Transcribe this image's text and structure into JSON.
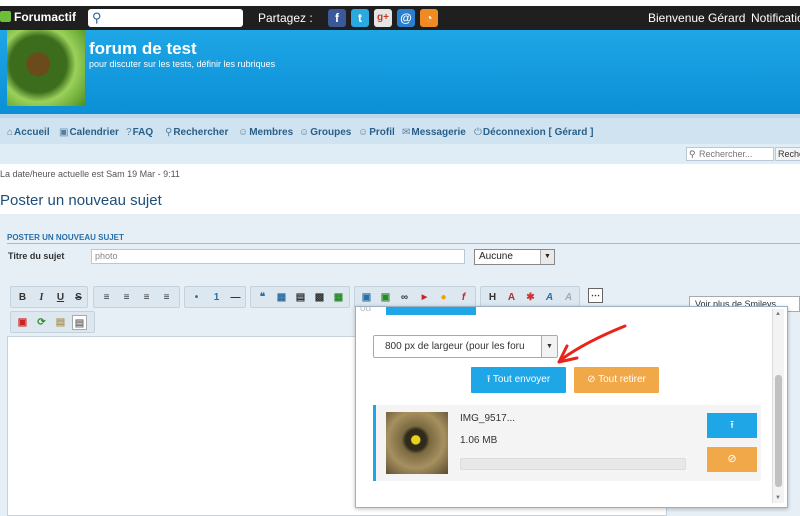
{
  "topbar": {
    "brand": "Forumactif",
    "share_label": "Partagez :",
    "social": [
      {
        "icon": "facebook-icon",
        "glyph": "f",
        "color": "#3b5998"
      },
      {
        "icon": "twitter-icon",
        "glyph": "t",
        "color": "#2aa9e0"
      },
      {
        "icon": "google-plus-icon",
        "glyph": "g+",
        "color": "#d9d9d9"
      },
      {
        "icon": "email-icon",
        "glyph": "@",
        "color": "#2a7fd0"
      },
      {
        "icon": "rss-icon",
        "glyph": "◔",
        "color": "#f08a24"
      }
    ],
    "welcome": "Bienvenue Gérard",
    "notifications": "Notification"
  },
  "header": {
    "title": "forum de test",
    "subtitle": "pour discuter sur les tests, définir les rubriques"
  },
  "nav": {
    "items": [
      {
        "label": "Accueil",
        "icon": "⌂"
      },
      {
        "label": "Calendrier",
        "icon": "▣"
      },
      {
        "label": "FAQ",
        "icon": "?"
      },
      {
        "label": "Rechercher",
        "icon": "⚲"
      },
      {
        "label": "Membres",
        "icon": "☺"
      },
      {
        "label": "Groupes",
        "icon": "☺"
      },
      {
        "label": "Profil",
        "icon": "☺"
      },
      {
        "label": "Messagerie",
        "icon": "✉"
      },
      {
        "label": "Déconnexion [ Gérard ]",
        "icon": "⏻"
      }
    ],
    "search_placeholder": "Rechercher...",
    "search_button": "Reche"
  },
  "date_text": "La date/heure actuelle est Sam 19 Mar - 9:11",
  "page_title": "Poster un nouveau sujet",
  "form": {
    "section_header": "POSTER UN NOUVEAU SUJET",
    "subject_label": "Titre du sujet",
    "subject_value": "photo",
    "icon_select": "Aucune",
    "more_smileys": "Voir plus de Smileys"
  },
  "upload": {
    "resize_option": "800 px de largeur (pour les foru",
    "send_all": "⭱ Tout envoyer",
    "remove_all": "⊘ Tout retirer",
    "file_name": "IMG_9517...",
    "file_size": "1.06 MB",
    "upload_glyph": "⭱",
    "cancel_glyph": "⊘",
    "progress": 0
  },
  "colors": {
    "header_blue": "#1ea6e6",
    "orange": "#f0a848",
    "arrow_red": "#e8241c"
  }
}
